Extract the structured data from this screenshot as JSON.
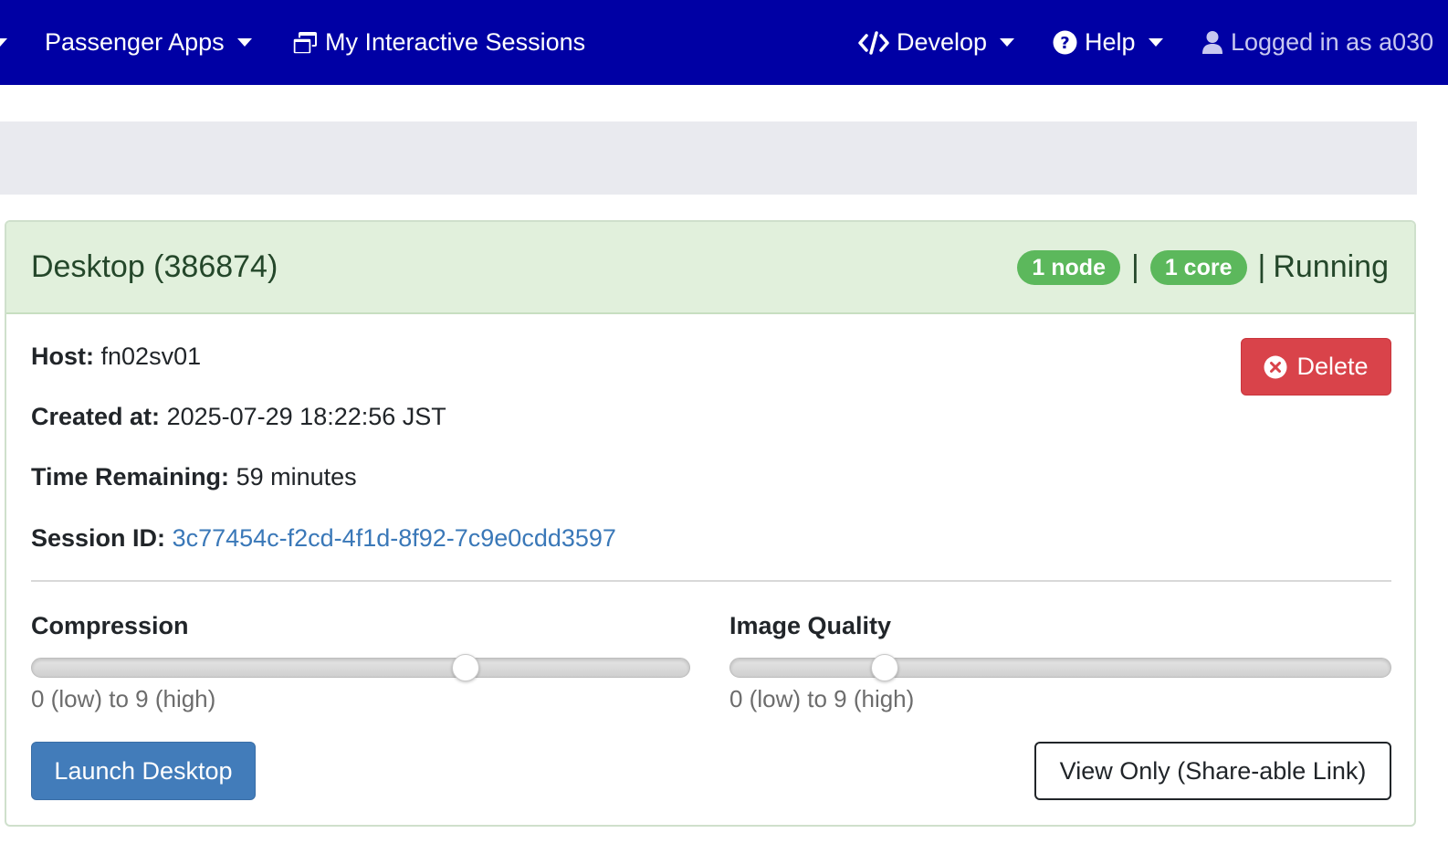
{
  "navbar": {
    "apps_label": "Passenger Apps",
    "sessions_label": "My Interactive Sessions",
    "develop_label": "Develop",
    "help_label": "Help",
    "user_label": "Logged in as a030"
  },
  "session": {
    "title": "Desktop (386874)",
    "nodes_badge": "1 node",
    "cores_badge": "1 core",
    "separator": "|",
    "status": "Running",
    "host_label": "Host:",
    "host_value": "fn02sv01",
    "created_label": "Created at:",
    "created_value": "2025-07-29 18:22:56 JST",
    "time_label": "Time Remaining:",
    "time_value": "59 minutes",
    "id_label": "Session ID:",
    "id_value": "3c77454c-f2cd-4f1d-8f92-7c9e0cdd3597",
    "delete_label": "Delete"
  },
  "controls": {
    "compression": {
      "label": "Compression",
      "value": 6,
      "min": 0,
      "max": 9,
      "help": "0 (low) to 9 (high)"
    },
    "image_quality": {
      "label": "Image Quality",
      "value": 2,
      "min": 0,
      "max": 9,
      "help": "0 (low) to 9 (high)"
    },
    "launch_label": "Launch Desktop",
    "view_only_label": "View Only (Share-able Link)"
  },
  "colors": {
    "navbar": "#0000a4",
    "success_badge": "#5cb85c",
    "delete": "#d9434a",
    "launch": "#427cba",
    "link": "#3a78b8"
  }
}
